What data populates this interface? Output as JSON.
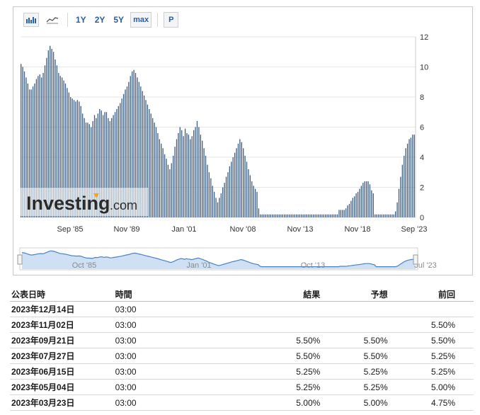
{
  "toolbar": {
    "range_buttons": [
      "1Y",
      "2Y",
      "5Y",
      "max"
    ],
    "p_button": "P"
  },
  "logo": {
    "brand": "Investing",
    "suffix": ".com"
  },
  "chart_data": {
    "type": "bar",
    "y_ticks": [
      "0",
      "2",
      "4",
      "6",
      "8",
      "10",
      "12"
    ],
    "ylim": [
      0,
      12
    ],
    "x_ticks": [
      "Sep '85",
      "Nov '89",
      "Jan '01",
      "Nov '08",
      "Nov '13",
      "Nov '18",
      "Sep '23"
    ],
    "navigator_ticks": [
      "Oct '85",
      "Jan '01",
      "Oct '13",
      "Jul '23"
    ],
    "grid": true,
    "bar_color": "#3f5f86",
    "navigator_color": "#4a82c0",
    "values": [
      10.2,
      10.0,
      9.7,
      9.3,
      8.9,
      8.5,
      8.5,
      8.7,
      8.9,
      9.2,
      9.4,
      9.5,
      9.3,
      9.6,
      10.1,
      10.6,
      11.1,
      11.4,
      11.2,
      11.0,
      10.5,
      10.1,
      9.6,
      9.4,
      9.3,
      9.1,
      8.9,
      8.6,
      8.3,
      8.0,
      7.9,
      7.8,
      7.7,
      7.8,
      7.7,
      7.4,
      6.9,
      6.6,
      6.3,
      6.3,
      6.2,
      6.0,
      6.4,
      6.8,
      6.6,
      6.9,
      7.2,
      7.1,
      6.8,
      7.0,
      7.0,
      6.6,
      6.4,
      6.6,
      6.8,
      7.0,
      7.2,
      7.4,
      7.6,
      7.9,
      8.2,
      8.5,
      8.7,
      9.0,
      9.4,
      9.7,
      9.8,
      9.6,
      9.3,
      9.0,
      8.7,
      8.4,
      8.1,
      7.8,
      7.5,
      7.2,
      6.9,
      6.6,
      6.3,
      6.0,
      5.6,
      5.2,
      4.9,
      4.6,
      4.2,
      3.9,
      3.5,
      3.2,
      3.6,
      4.1,
      4.7,
      5.2,
      5.6,
      6.0,
      5.8,
      5.4,
      5.9,
      5.6,
      5.5,
      5.2,
      5.4,
      5.8,
      6.0,
      6.4,
      6.0,
      5.5,
      5.1,
      4.6,
      4.1,
      3.5,
      3.0,
      2.6,
      2.1,
      1.7,
      1.3,
      1.0,
      1.3,
      1.6,
      2.0,
      2.3,
      2.7,
      3.0,
      3.4,
      3.7,
      4.0,
      4.3,
      4.6,
      4.9,
      5.2,
      5.0,
      4.6,
      4.1,
      3.7,
      3.2,
      2.8,
      2.4,
      2.1,
      1.9,
      1.7,
      0.6,
      0.2,
      0.2,
      0.2,
      0.2,
      0.2,
      0.2,
      0.2,
      0.2,
      0.2,
      0.2,
      0.2,
      0.2,
      0.2,
      0.2,
      0.2,
      0.2,
      0.2,
      0.2,
      0.2,
      0.2,
      0.2,
      0.2,
      0.2,
      0.2,
      0.2,
      0.2,
      0.2,
      0.2,
      0.2,
      0.2,
      0.2,
      0.2,
      0.2,
      0.2,
      0.2,
      0.2,
      0.2,
      0.2,
      0.2,
      0.2,
      0.2,
      0.2,
      0.2,
      0.2,
      0.2,
      0.2,
      0.5,
      0.5,
      0.5,
      0.5,
      0.6,
      0.8,
      0.9,
      1.1,
      1.3,
      1.4,
      1.6,
      1.7,
      1.9,
      2.1,
      2.3,
      2.4,
      2.4,
      2.4,
      2.2,
      1.8,
      1.6,
      0.2,
      0.2,
      0.2,
      0.2,
      0.2,
      0.2,
      0.2,
      0.2,
      0.2,
      0.2,
      0.2,
      0.2,
      0.4,
      1.0,
      1.9,
      2.7,
      3.5,
      4.1,
      4.6,
      4.9,
      5.2,
      5.3,
      5.5,
      5.5
    ]
  },
  "table": {
    "headers": {
      "date": "公表日時",
      "time": "時間",
      "actual": "結果",
      "forecast": "予想",
      "previous": "前回"
    },
    "rows": [
      {
        "date": "2023年12月14日",
        "time": "03:00",
        "actual": "",
        "forecast": "",
        "previous": ""
      },
      {
        "date": "2023年11月02日",
        "time": "03:00",
        "actual": "",
        "forecast": "",
        "previous": "5.50%"
      },
      {
        "date": "2023年09月21日",
        "time": "03:00",
        "actual": "5.50%",
        "forecast": "5.50%",
        "previous": "5.50%"
      },
      {
        "date": "2023年07月27日",
        "time": "03:00",
        "actual": "5.50%",
        "forecast": "5.50%",
        "previous": "5.25%"
      },
      {
        "date": "2023年06月15日",
        "time": "03:00",
        "actual": "5.25%",
        "forecast": "5.25%",
        "previous": "5.25%"
      },
      {
        "date": "2023年05月04日",
        "time": "03:00",
        "actual": "5.25%",
        "forecast": "5.25%",
        "previous": "5.00%"
      },
      {
        "date": "2023年03月23日",
        "time": "03:00",
        "actual": "5.00%",
        "forecast": "5.00%",
        "previous": "4.75%"
      }
    ]
  }
}
